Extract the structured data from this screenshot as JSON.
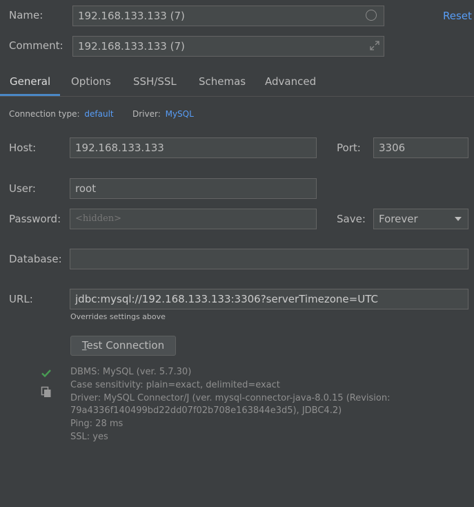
{
  "name": {
    "label": "Name:",
    "value": "192.168.133.133  (7)"
  },
  "comment": {
    "label": "Comment:",
    "value": "192.168.133.133  (7)"
  },
  "reset_label": "Reset",
  "tabs": [
    {
      "label": "General"
    },
    {
      "label": "Options"
    },
    {
      "label": "SSH/SSL"
    },
    {
      "label": "Schemas"
    },
    {
      "label": "Advanced"
    }
  ],
  "connection_type": {
    "label": "Connection type:",
    "value": "default"
  },
  "driver": {
    "label": "Driver:",
    "value": "MySQL"
  },
  "host": {
    "label": "Host:",
    "value": "192.168.133.133"
  },
  "port": {
    "label": "Port:",
    "value": "3306"
  },
  "user": {
    "label": "User:",
    "value": "root"
  },
  "password": {
    "label": "Password:",
    "placeholder": "<hidden>"
  },
  "save": {
    "label": "Save:",
    "value": "Forever"
  },
  "database": {
    "label": "Database:",
    "value": ""
  },
  "url": {
    "label": "URL:",
    "value": "jdbc:mysql://192.168.133.133:3306?serverTimezone=UTC",
    "hint": "Overrides settings above"
  },
  "test_connection": {
    "mnemonic": "T",
    "rest": "est Connection"
  },
  "result": {
    "lines": [
      "DBMS: MySQL (ver. 5.7.30)",
      "Case sensitivity: plain=exact, delimited=exact",
      "Driver: MySQL Connector/J (ver. mysql-connector-java-8.0.15 (Revision:",
      "79a4336f140499bd22dd07f02b708e163844e3d5), JDBC4.2)",
      "Ping: 28 ms",
      "SSL: yes"
    ]
  },
  "icons": {
    "success": "check-icon",
    "copy": "copy-icon",
    "name_field": "circle-icon",
    "comment_field": "expand-icon",
    "save_select": "triangle-down-icon"
  },
  "colors": {
    "background": "#3c3f41",
    "field_bg": "#45494a",
    "link": "#589df6",
    "success": "#499c54",
    "tab_underline": "#4a88c7"
  }
}
